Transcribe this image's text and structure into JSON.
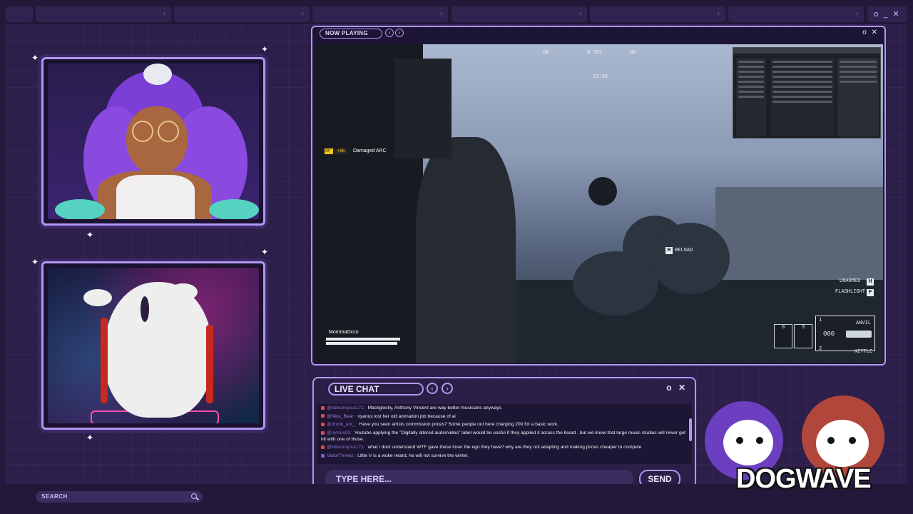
{
  "colors": {
    "accent": "#b497f0",
    "background": "#2c1f4a",
    "panel": "#2a1f47",
    "chat_user": "#8b75c9"
  },
  "now_playing": {
    "label": "NOW PLAYING",
    "prev_icon": "chevron-left-icon",
    "next_icon": "chevron-right-icon",
    "controls": "o ✕"
  },
  "game_hud": {
    "compass": [
      "SK",
      "N 281",
      "NW"
    ],
    "time": "15:08",
    "xp_badge": "XP",
    "xp_value": "+96",
    "xp_text": "Damaged ARC",
    "player_name": "MommaOcco",
    "prompt_key": "R",
    "prompt_text": "RELOAD",
    "unarmed_label": "UNARMED",
    "unarmed_key": "H",
    "flashlight_label": "FLASHLIGHT",
    "flashlight_key": "F",
    "slot1_num": "1",
    "slot1_name": "ANVIL",
    "ammo": "000",
    "slot2_num": "2",
    "slot2_name": "KETTLE",
    "slot_a": "0",
    "slot_b": "3"
  },
  "chat": {
    "title": "LIVE CHAT",
    "controls": "o ✕",
    "messages": [
      {
        "user": "@kdestroyout171:",
        "text": "Mackglocky, Anthony Vincent are way better musicians anyways"
      },
      {
        "user": "@Nice_Bear:",
        "text": "nyanus lost her old animation job because of ai"
      },
      {
        "user": "@drunk_ant_:",
        "text": "Have you seen artists commission prices? Some people out here charging 200 for a basic work."
      },
      {
        "user": "@cymus02:",
        "text": "Youtube applying the \"Digitally altered audio/video\" label would be useful if they applied it across the board , but we know that large music studios will never get hit with one of those."
      },
      {
        "user": "@kdestroyout171:",
        "text": "what i dont understand WTF gave these loser the ego they have? why are they not adapting and making prices cheaper to compete"
      },
      {
        "user": "VictorThreez:",
        "text": "Little V is a woke retard, he will not survive the winter."
      }
    ],
    "input_placeholder": "TYPE HERE...",
    "send_label": "SEND"
  },
  "search": {
    "placeholder": "SEARCH",
    "icon": "search-icon"
  },
  "logo": {
    "text": "DOGWAVE"
  },
  "window": {
    "controls": "o _ ✕"
  }
}
